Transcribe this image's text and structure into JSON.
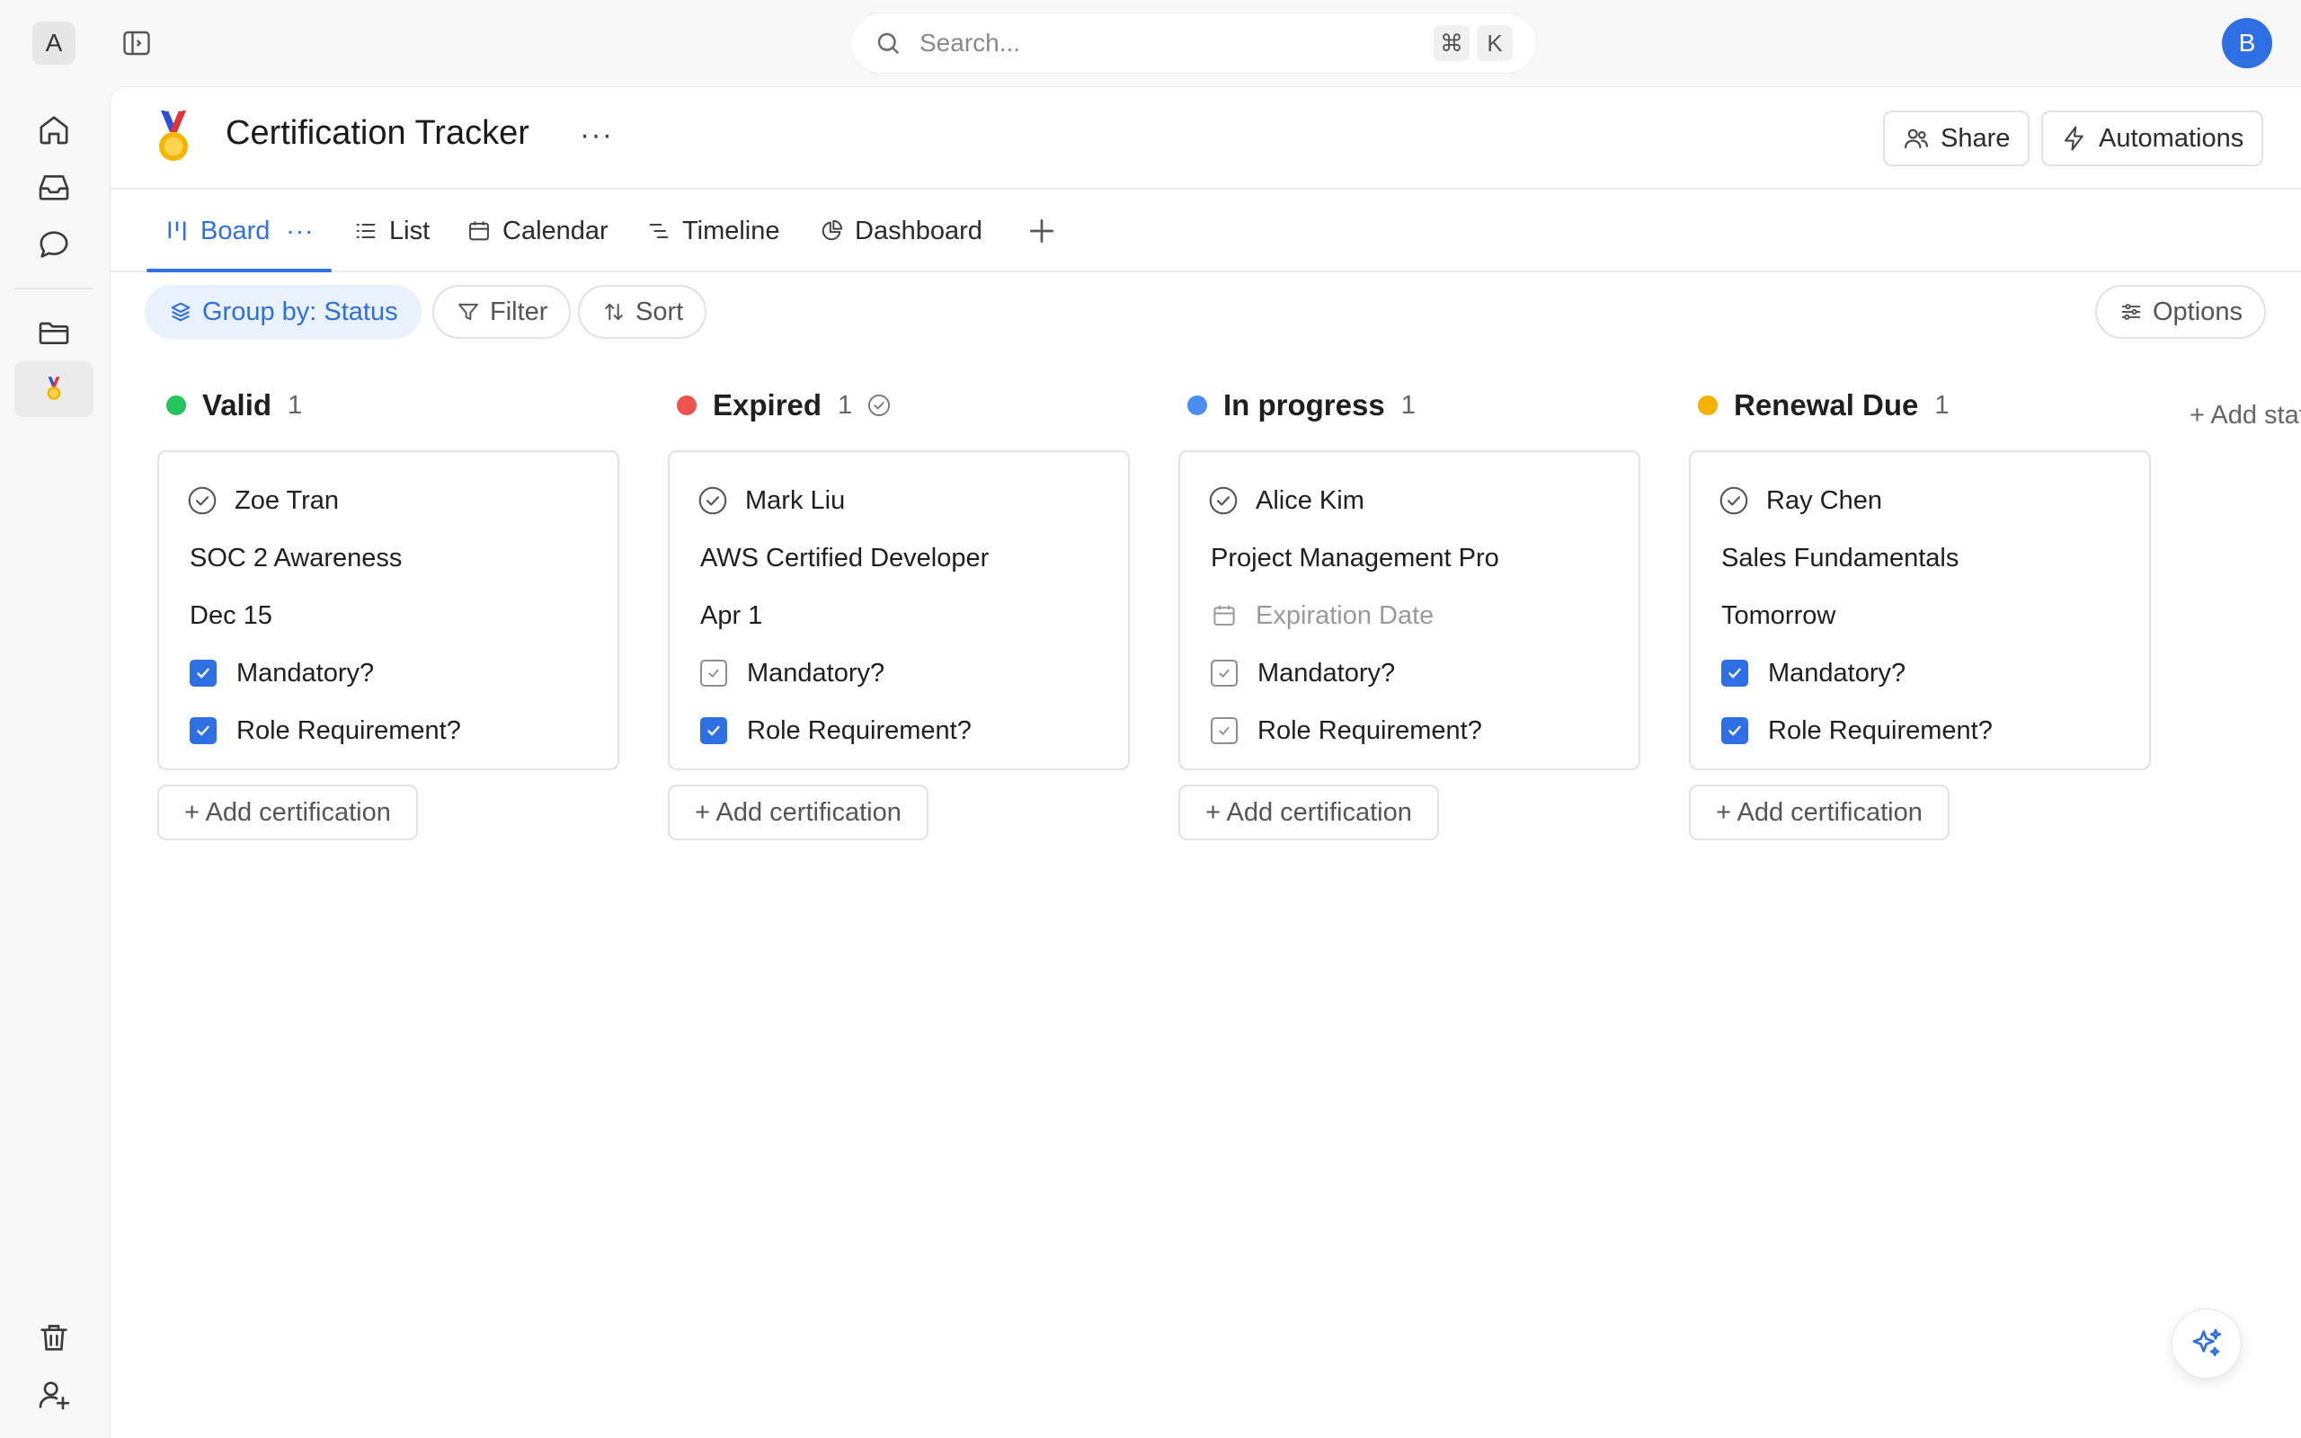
{
  "workspace": {
    "initial": "A"
  },
  "search": {
    "placeholder": "Search...",
    "shortcut_mod": "⌘",
    "shortcut_key": "K"
  },
  "user": {
    "initial": "B"
  },
  "page": {
    "title": "Certification Tracker",
    "emoji": "medal-icon"
  },
  "header": {
    "share_label": "Share",
    "automations_label": "Automations"
  },
  "tabs": [
    {
      "label": "Board",
      "icon": "board-icon",
      "active": true
    },
    {
      "label": "List",
      "icon": "list-icon"
    },
    {
      "label": "Calendar",
      "icon": "calendar-icon"
    },
    {
      "label": "Timeline",
      "icon": "timeline-icon"
    },
    {
      "label": "Dashboard",
      "icon": "dashboard-icon"
    }
  ],
  "toolbar": {
    "group_label": "Group by: Status",
    "filter_label": "Filter",
    "sort_label": "Sort",
    "options_label": "Options"
  },
  "colors": {
    "accent": "#2f6fe4",
    "valid": "#22c55e",
    "expired": "#ef5350",
    "in_progress": "#4a8ef5",
    "renewal_due": "#f5b000"
  },
  "columns": [
    {
      "title": "Valid",
      "count": "1",
      "color": "#22c55e",
      "card": {
        "name": "Zoe Tran",
        "certification": "SOC 2 Awareness",
        "expiration": "Dec 15",
        "mandatory_label": "Mandatory?",
        "mandatory": true,
        "role_label": "Role Requirement?",
        "role": true
      },
      "add_label": "+ Add certification"
    },
    {
      "title": "Expired",
      "count": "1",
      "color": "#ef5350",
      "card": {
        "name": "Mark Liu",
        "certification": "AWS Certified Developer",
        "expiration": "Apr 1",
        "mandatory_label": "Mandatory?",
        "mandatory": false,
        "role_label": "Role Requirement?",
        "role": true
      },
      "add_label": "+ Add certification"
    },
    {
      "title": "In progress",
      "count": "1",
      "color": "#4a8ef5",
      "card": {
        "name": "Alice Kim",
        "certification": "Project Management Pro",
        "expiration_placeholder": "Expiration Date",
        "mandatory_label": "Mandatory?",
        "mandatory": false,
        "role_label": "Role Requirement?",
        "role": false
      },
      "add_label": "+ Add certification"
    },
    {
      "title": "Renewal Due",
      "count": "1",
      "color": "#f5b000",
      "card": {
        "name": "Ray Chen",
        "certification": "Sales Fundamentals",
        "expiration": "Tomorrow",
        "mandatory_label": "Mandatory?",
        "mandatory": true,
        "role_label": "Role Requirement?",
        "role": true
      },
      "add_label": "+ Add certification"
    }
  ],
  "add_status_label": "+ Add status"
}
